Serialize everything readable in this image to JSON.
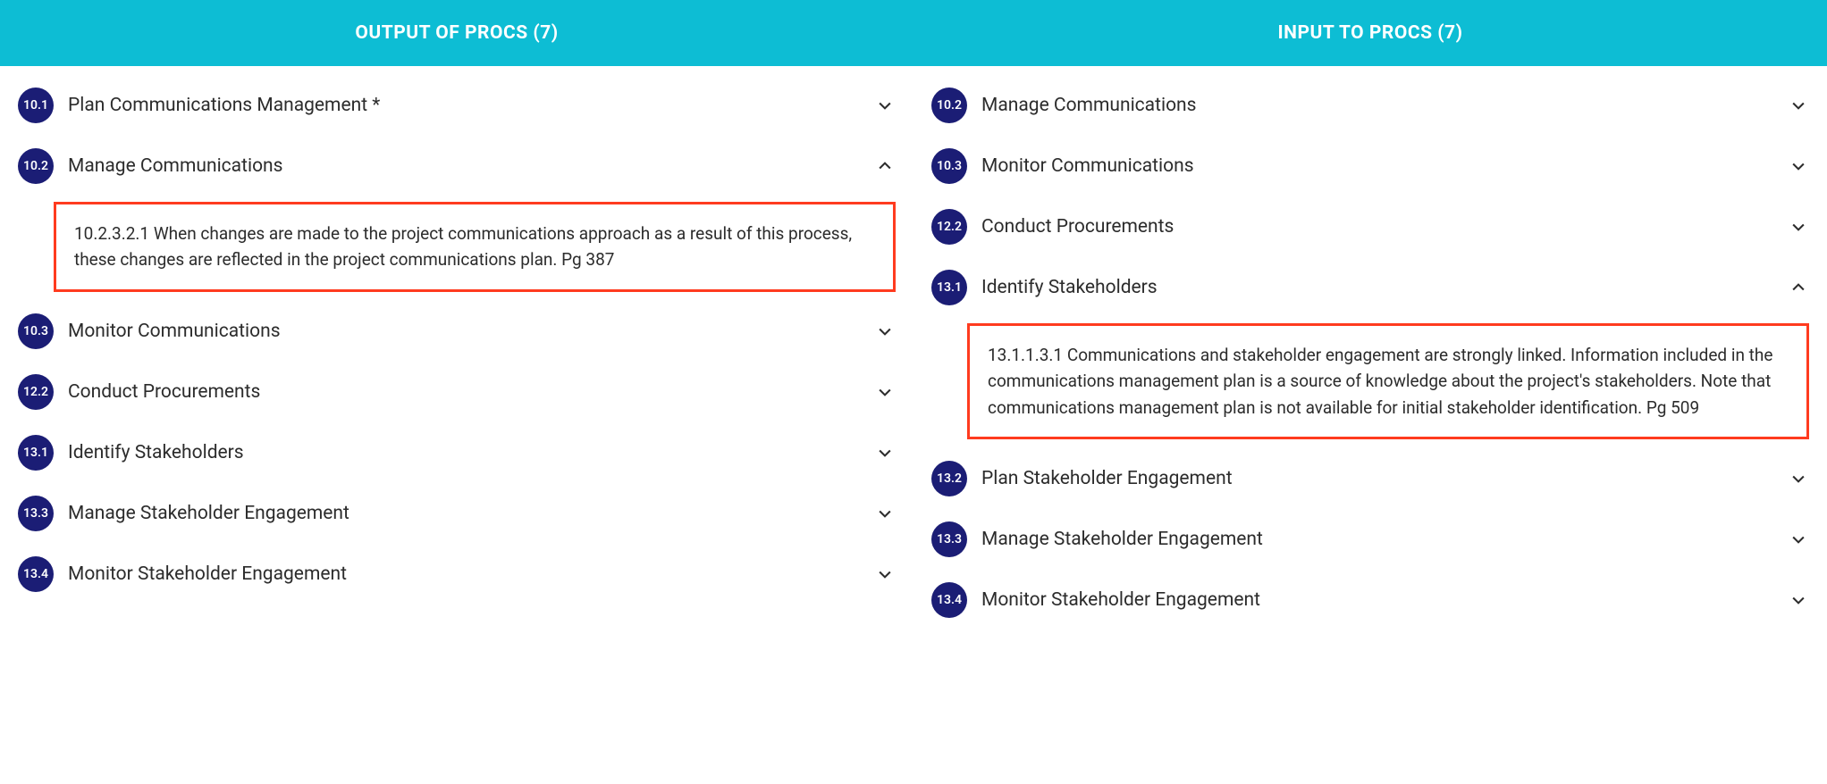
{
  "headers": {
    "left": "OUTPUT OF PROCS (7)",
    "right": "INPUT TO PROCS (7)"
  },
  "left": {
    "items": [
      {
        "badge": "10.1",
        "label": "Plan Communications Management *",
        "expanded": false
      },
      {
        "badge": "10.2",
        "label": "Manage Communications",
        "expanded": true,
        "detail": "10.2.3.2.1 When changes are made to the project communications approach as a result of this process, these changes are reflected in the project communications plan. Pg 387"
      },
      {
        "badge": "10.3",
        "label": "Monitor Communications",
        "expanded": false
      },
      {
        "badge": "12.2",
        "label": "Conduct Procurements",
        "expanded": false
      },
      {
        "badge": "13.1",
        "label": "Identify Stakeholders",
        "expanded": false
      },
      {
        "badge": "13.3",
        "label": "Manage Stakeholder Engagement",
        "expanded": false
      },
      {
        "badge": "13.4",
        "label": "Monitor Stakeholder Engagement",
        "expanded": false
      }
    ]
  },
  "right": {
    "items": [
      {
        "badge": "10.2",
        "label": "Manage Communications",
        "expanded": false
      },
      {
        "badge": "10.3",
        "label": "Monitor Communications",
        "expanded": false
      },
      {
        "badge": "12.2",
        "label": "Conduct Procurements",
        "expanded": false
      },
      {
        "badge": "13.1",
        "label": "Identify Stakeholders",
        "expanded": true,
        "detail": "13.1.1.3.1 Communications and stakeholder engagement are strongly linked. Information included in the communications management plan is a source of knowledge about the project's stakeholders. Note that communications management plan is not available for initial stakeholder identification. Pg 509"
      },
      {
        "badge": "13.2",
        "label": "Plan Stakeholder Engagement",
        "expanded": false
      },
      {
        "badge": "13.3",
        "label": "Manage Stakeholder Engagement",
        "expanded": false
      },
      {
        "badge": "13.4",
        "label": "Monitor Stakeholder Engagement",
        "expanded": false
      }
    ]
  }
}
